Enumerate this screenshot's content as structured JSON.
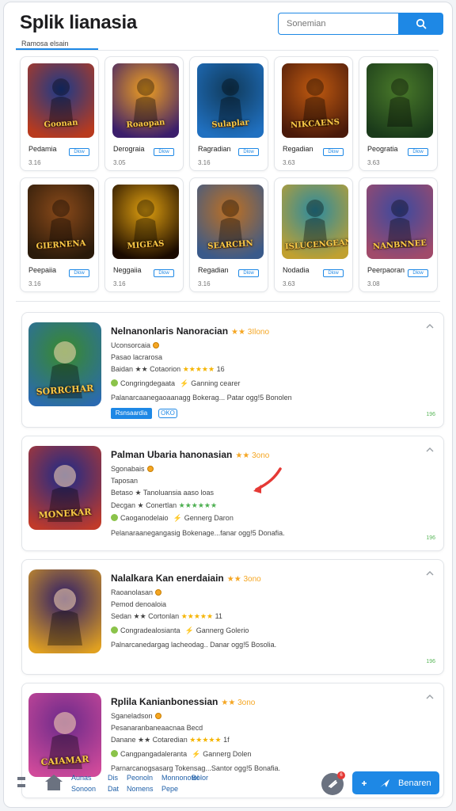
{
  "header": {
    "title": "Splik lianasia",
    "search_placeholder": "Sonemian",
    "subtab_label": "Ramosa elsain"
  },
  "grid": [
    {
      "name": "Pedamia",
      "button": "Dlow",
      "sub": "3.16",
      "tag": "Goonan",
      "colors": [
        "#1a3a8a",
        "#b83a1e"
      ]
    },
    {
      "name": "Derograia",
      "button": "Dlow",
      "sub": "3.05",
      "tag": "Roaopan",
      "colors": [
        "#f0a020",
        "#3b1e6b"
      ]
    },
    {
      "name": "Ragradian",
      "button": "Dlow",
      "sub": "3.16",
      "tag": "Sulaplar",
      "colors": [
        "#103a5a",
        "#2070c0"
      ]
    },
    {
      "name": "Regadian",
      "button": "Dlow",
      "sub": "3.63",
      "tag": "NIKCAENS",
      "colors": [
        "#c05a10",
        "#4a1a0a"
      ]
    },
    {
      "name": "Peogratia",
      "button": "Dlow",
      "sub": "3.63",
      "tag": "",
      "colors": [
        "#4a7a2a",
        "#1a3a1a"
      ]
    },
    {
      "name": "Peepaiia",
      "button": "Dlow",
      "sub": "3.16",
      "tag": "GIERNENA",
      "colors": [
        "#8a4a1a",
        "#2a1a0a"
      ]
    },
    {
      "name": "Neggaiia",
      "button": "Dlow",
      "sub": "3.16",
      "tag": "MIGEAS",
      "colors": [
        "#e0a010",
        "#1a0a00"
      ]
    },
    {
      "name": "Regadian",
      "button": "Dlow",
      "sub": "3.16",
      "tag": "SEARCHN",
      "colors": [
        "#c07020",
        "#3a5a8a"
      ]
    },
    {
      "name": "Nodadia",
      "button": "Dlow",
      "sub": "3.63",
      "tag": "ISLUCENGEAN",
      "colors": [
        "#2a8aa0",
        "#c0a030"
      ]
    },
    {
      "name": "Peerpaoran",
      "button": "Dlow",
      "sub": "3.08",
      "tag": "NANBNNEE",
      "colors": [
        "#3a4aa0",
        "#a04a6a"
      ]
    }
  ],
  "list": [
    {
      "title": "Nelnanonlaris Nanoracian",
      "title_stars": "★★ 3Ilono",
      "line1": "Uconsorcaia",
      "line2": "Pasao lacrarosa",
      "line3_prefix": "Baidan ★★ Cotaorion",
      "line3_stars": "★★★★★",
      "line3_suffix": "16",
      "line4": "Congringdegaata",
      "line4_extra": "Ganning cearer",
      "line5": "Palanarcaanegaoaanagg Bokerag... Patar ogg!5 Bonolen",
      "primary_button": "Rsnsaardia",
      "secondary_button": "OKO",
      "size": "196",
      "tag": "SORRCHAR",
      "colors": [
        "#3a8a2a",
        "#2a6ab0"
      ]
    },
    {
      "title": "Palman Ubaria hanonasian",
      "title_stars": "★★ 3ono",
      "line1": "Sgonabais",
      "line2": "Taposan",
      "line3_prefix": "Betaso ★ Tanoluansia aaso loas",
      "line3_stars": "",
      "line3_suffix": "",
      "line4_prefix": "Decgan ★ Conertlan",
      "line4_stars": "★★★★★★",
      "line4": "Caoganodelaio",
      "line4_extra": "Gennerg Daron",
      "line5": "Pelanaraanegangasig Bokenage...fanar ogg!5 Donafia.",
      "size": "196",
      "tag": "MONEKAR",
      "colors": [
        "#1a2a8a",
        "#c03a2a"
      ]
    },
    {
      "title": "Nalalkara Kan enerdaiain",
      "title_stars": "★★ 3ono",
      "line1": "Raoanolasan",
      "line2": "Pemod denoaloia",
      "line3_prefix": "Sedan ★★ Cortonlan",
      "line3_stars": "★★★★★",
      "line3_suffix": "11",
      "line4": "Congradealosianta",
      "line4_extra": "Gannerg Golerio",
      "line5": "Palnarcanedargag lacheodag.. Danar ogg!5 Bosolia.",
      "size": "196",
      "tag": "",
      "colors": [
        "#2a1a6a",
        "#e0a020"
      ]
    },
    {
      "title": "Rplila Kanianbonessian",
      "title_stars": "★★ 3ono",
      "line1": "Sganeladson",
      "line2": "Pesanaranbaneaacnaa Becd",
      "line3_prefix": "Danane ★★ Cotaredian",
      "line3_stars": "★★★★★",
      "line3_suffix": "1f",
      "line4": "Cangpangadaleranta",
      "line4_extra": "Gannerg Dolen",
      "line5": "Parnarcanogsasarg Tokensag...Santor ogg!5 Bonafia.",
      "size": "196",
      "tag": "CAIAMAR",
      "colors": [
        "#6a2a8a",
        "#d04a9a"
      ]
    }
  ],
  "bottom_bar": {
    "col1": [
      "Aunas",
      "Sonoon"
    ],
    "col2": [
      "Dis",
      "Dat"
    ],
    "col3": [
      "Peonoln",
      "Nomens"
    ],
    "col4": [
      "Monnonotel",
      "Pepe"
    ],
    "col5": [
      "",
      "Bolor"
    ],
    "badge_count": "6",
    "action_label": "Benaren"
  },
  "colors": {
    "accent": "#1e88e5",
    "star": "#f5b400",
    "size_green": "#5cb85c"
  }
}
